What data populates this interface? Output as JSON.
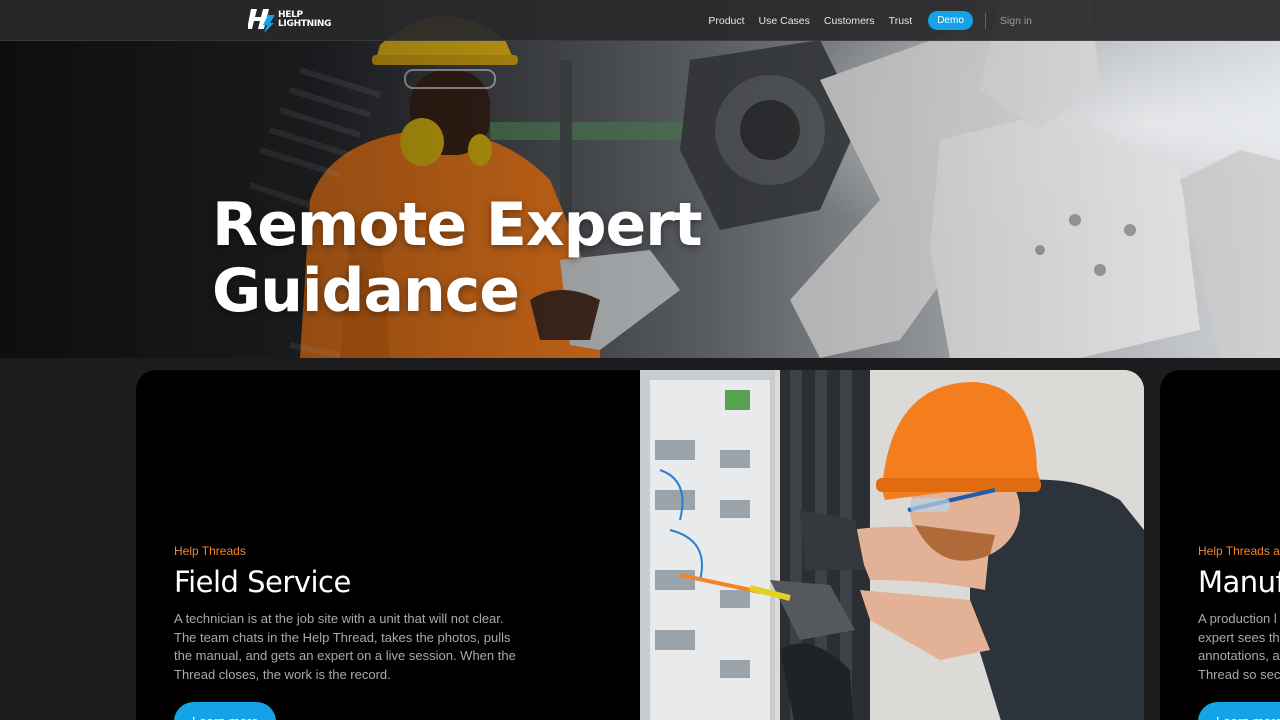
{
  "nav": {
    "logo_line1": "HELP",
    "logo_line2": "LIGHTNING",
    "links": [
      "Product",
      "Use Cases",
      "Customers",
      "Trust"
    ],
    "demo_label": "Demo",
    "signin_label": "Sign in"
  },
  "hero": {
    "title_line1": "Remote Expert",
    "title_line2": "Guidance"
  },
  "cards": [
    {
      "kicker": "Help Threads",
      "title": "Field Service",
      "body": "A technician is at the job site with a unit that will not clear. The team chats in the Help Thread, takes the photos, pulls the manual, and gets an expert on a live session. When the Thread closes, the work is the record.",
      "button": "Learn more"
    },
    {
      "kicker": "Help Threads a",
      "title": "Manuf",
      "body_lines": [
        "A production l",
        "expert sees th",
        "annotations, a",
        "Thread so sec"
      ],
      "button": "Learn more"
    }
  ],
  "colors": {
    "accent_blue": "#13a3e6",
    "kicker_orange": "#f0862a",
    "hardhat_orange": "#f47d1e",
    "hardhat_yellow": "#f2c21a"
  }
}
